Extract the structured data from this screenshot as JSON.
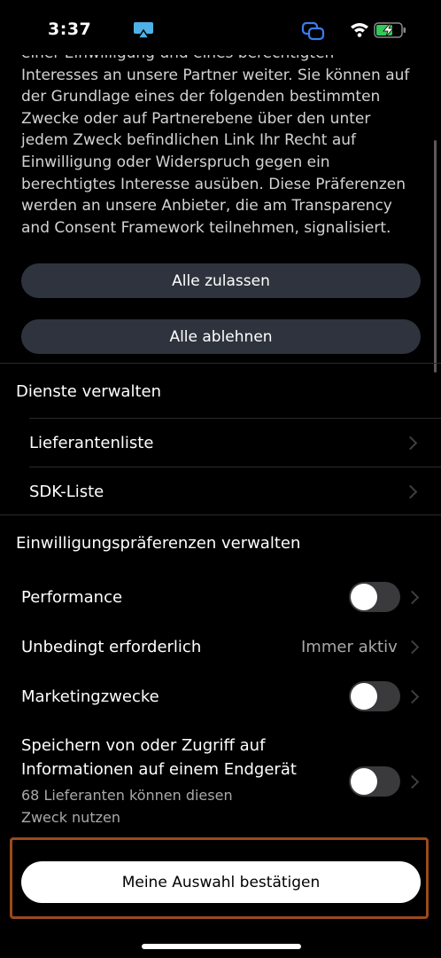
{
  "status_bar": {
    "time": "3:37"
  },
  "intro_lines": [
    "einer Einwilligung und eines berechtigten",
    "Interesses an unsere Partner weiter. Sie können auf",
    "der Grundlage eines der folgenden bestimmten",
    "Zwecke oder auf Partnerebene über den unter",
    "jedem Zweck befindlichen Link Ihr Recht auf",
    "Einwilligung oder Widerspruch gegen ein",
    "berechtigtes Interesse ausüben. Diese Präferenzen",
    "werden an unsere Anbieter, die am Transparency",
    "and Consent Framework teilnehmen, signalisiert."
  ],
  "buttons": {
    "allow_all": "Alle zulassen",
    "reject_all": "Alle ablehnen",
    "confirm": "Meine Auswahl bestätigen"
  },
  "services": {
    "title": "Dienste verwalten",
    "items": [
      "Lieferantenliste",
      "SDK-Liste"
    ]
  },
  "preferences": {
    "title": "Einwilligungspräferenzen verwalten",
    "performance": {
      "label": "Performance",
      "enabled": false
    },
    "required": {
      "label": "Unbedingt erforderlich",
      "status": "Immer aktiv"
    },
    "marketing": {
      "label": "Marketingzwecke",
      "enabled": false
    },
    "storage": {
      "label_line1": "Speichern von oder Zugriff auf",
      "label_line2": "Informationen auf einem Endgerät",
      "sub_line1": "68 Lieferanten können diesen",
      "sub_line2": "Zweck nutzen",
      "enabled": false
    }
  }
}
